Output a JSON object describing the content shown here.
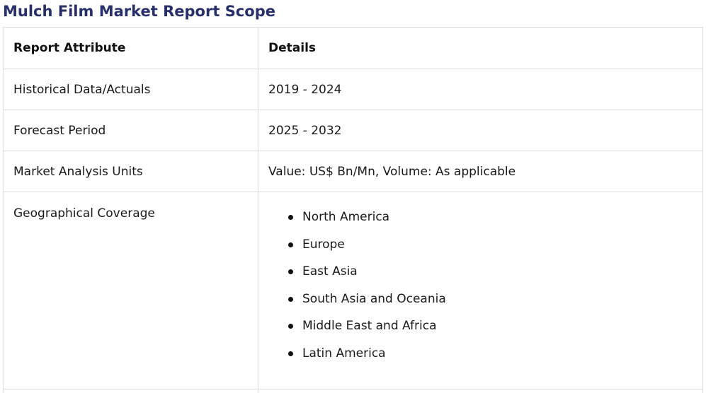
{
  "title": "Mulch Film Market Report Scope",
  "table": {
    "headers": [
      "Report Attribute",
      "Details"
    ],
    "rows": [
      {
        "attribute": "Historical Data/Actuals",
        "details": "2019 - 2024"
      },
      {
        "attribute": "Forecast Period",
        "details": "2025 - 2032"
      },
      {
        "attribute": "Market Analysis Units",
        "details": "Value: US$ Bn/Mn, Volume: As applicable"
      }
    ],
    "geo": {
      "attribute": "Geographical Coverage",
      "regions": [
        "North America",
        "Europe",
        "East Asia",
        "South Asia and Oceania",
        "Middle East and Africa",
        "Latin America"
      ]
    }
  }
}
